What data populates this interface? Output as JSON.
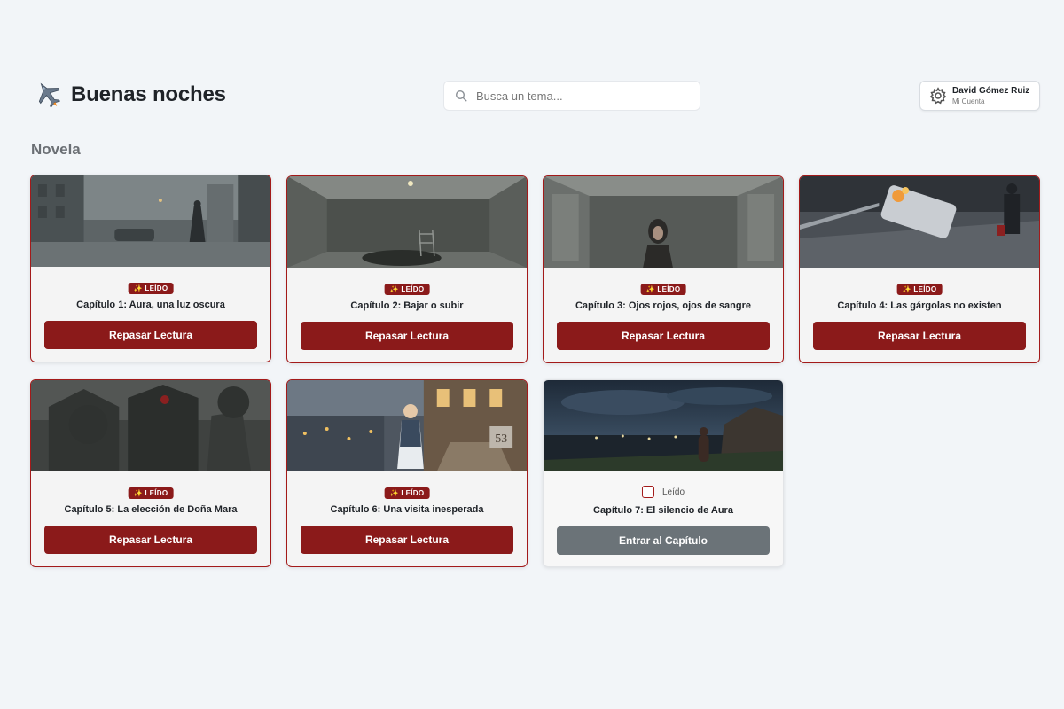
{
  "header": {
    "greeting": "Buenas noches",
    "greeting_icon": "fighter-jet-icon",
    "search": {
      "placeholder": "Busca un tema...",
      "value": ""
    },
    "account": {
      "name": "David Gómez Ruiz",
      "subtitle": "Mi Cuenta",
      "icon": "gear-icon"
    }
  },
  "section": {
    "title": "Novela"
  },
  "colors": {
    "accent": "#8b1a1a",
    "accent_border": "#a31a1a",
    "unread_button": "#6b7378",
    "background": "#f2f5f8"
  },
  "chapters": [
    {
      "title": "Capítulo 1: Aura, una luz oscura",
      "status": "read",
      "badge": "✨ LEÍDO",
      "button": "Repasar Lectura"
    },
    {
      "title": "Capítulo 2: Bajar o subir",
      "status": "read",
      "badge": "✨ LEÍDO",
      "button": "Repasar Lectura"
    },
    {
      "title": "Capítulo 3: Ojos rojos, ojos de sangre",
      "status": "read",
      "badge": "✨ LEÍDO",
      "button": "Repasar Lectura"
    },
    {
      "title": "Capítulo 4: Las gárgolas no existen",
      "status": "read",
      "badge": "✨ LEÍDO",
      "button": "Repasar Lectura"
    },
    {
      "title": "Capítulo 5: La elección de Doña Mara",
      "status": "read",
      "badge": "✨ LEÍDO",
      "button": "Repasar Lectura"
    },
    {
      "title": "Capítulo 6: Una visita inesperada",
      "status": "read",
      "badge": "✨ LEÍDO",
      "button": "Repasar Lectura"
    },
    {
      "title": "Capítulo 7: El silencio de Aura",
      "status": "unread",
      "checkbox_label": "Leído",
      "button": "Entrar al Capítulo"
    }
  ]
}
